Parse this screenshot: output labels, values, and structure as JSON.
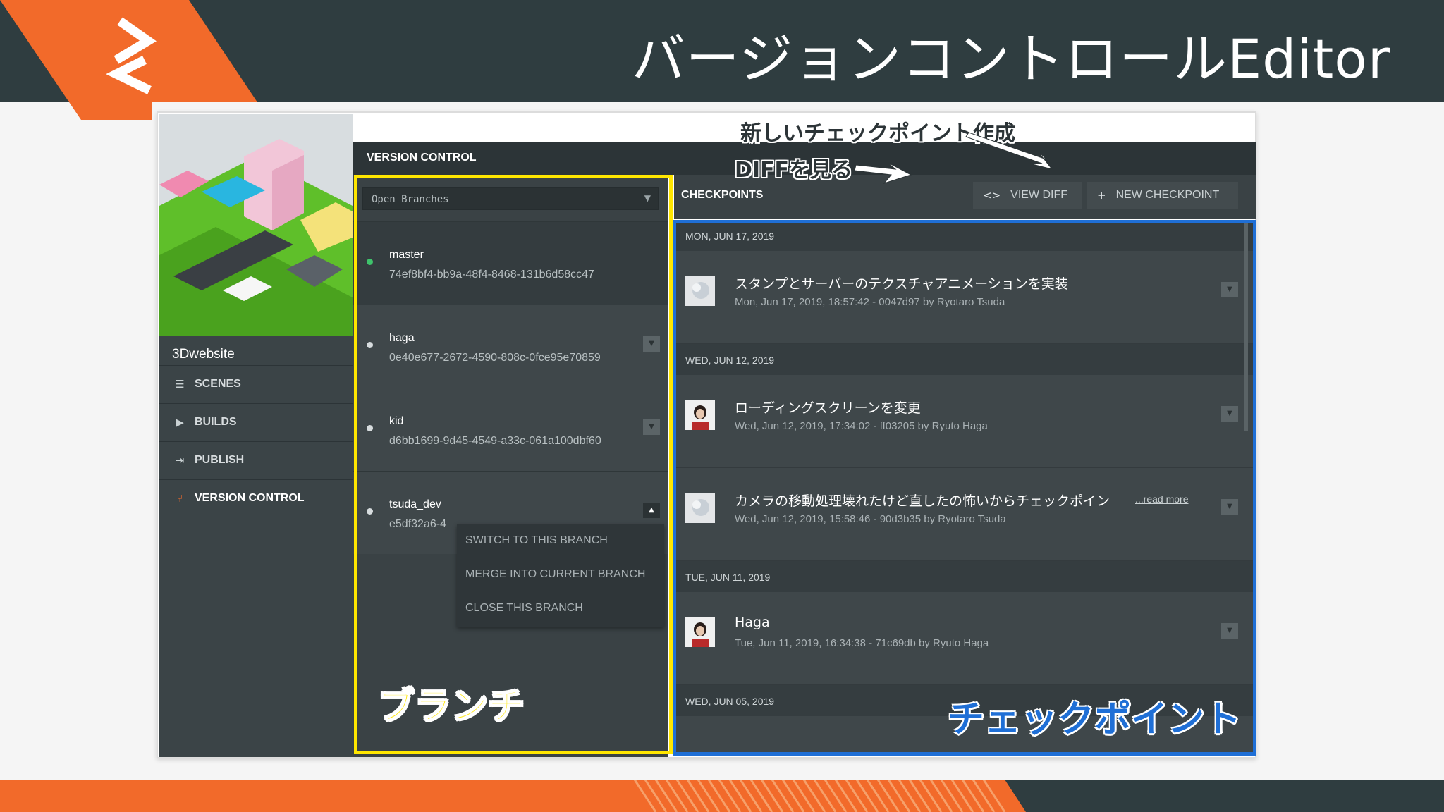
{
  "slide": {
    "title": "バージョンコントロールEditor",
    "colors": {
      "dark": "#2f3d40",
      "accent": "#f26a2a"
    }
  },
  "annotations": {
    "new_checkpoint": "新しいチェックポイント作成",
    "view_diff": "DIFFを見る",
    "branch": "ブランチ",
    "checkpoint": "チェックポイント",
    "colors": {
      "branch_highlight": "#ffe600",
      "checkpoint_highlight": "#1f6fd6"
    }
  },
  "app": {
    "project_name": "3Dwebsite",
    "nav": [
      {
        "label": "SCENES",
        "icon": "list-icon"
      },
      {
        "label": "BUILDS",
        "icon": "play-icon"
      },
      {
        "label": "PUBLISH",
        "icon": "publish-icon"
      },
      {
        "label": "VERSION CONTROL",
        "icon": "branch-icon",
        "active": true
      }
    ],
    "vc_title": "VERSION CONTROL",
    "branches": {
      "selector_label": "Open Branches",
      "items": [
        {
          "name": "master",
          "hash": "74ef8bf4-bb9a-48f4-8468-131b6d58cc47",
          "current": true
        },
        {
          "name": "haga",
          "hash": "0e40e677-2672-4590-808c-0fce95e70859"
        },
        {
          "name": "kid",
          "hash": "d6bb1699-9d45-4549-a33c-061a100dbf60"
        },
        {
          "name": "tsuda_dev",
          "hash": "e5df32a6-4"
        }
      ],
      "context_menu": [
        "SWITCH TO THIS BRANCH",
        "MERGE INTO CURRENT BRANCH",
        "CLOSE THIS BRANCH"
      ]
    },
    "checkpoints": {
      "title": "CHECKPOINTS",
      "view_diff_label": "VIEW DIFF",
      "new_checkpoint_label": "NEW CHECKPOINT",
      "read_more": "...read more",
      "groups": [
        {
          "date": "MON, JUN 17, 2019",
          "items": [
            {
              "message": "スタンプとサーバーのテクスチャアニメーションを実装",
              "meta": "Mon, Jun 17, 2019, 18:57:42 - 0047d97 by Ryotaro Tsuda"
            }
          ]
        },
        {
          "date": "WED, JUN 12, 2019",
          "items": [
            {
              "message": "ローディングスクリーンを変更",
              "meta": "Wed, Jun 12, 2019, 17:34:02 - ff03205 by Ryuto Haga"
            },
            {
              "message": "カメラの移動処理壊れたけど直したの怖いからチェックポイン",
              "meta": "Wed, Jun 12, 2019, 15:58:46 - 90d3b35 by Ryotaro Tsuda"
            }
          ]
        },
        {
          "date": "TUE, JUN 11, 2019",
          "items": [
            {
              "message": "Haga",
              "meta": "Tue, Jun 11, 2019, 16:34:38 - 71c69db by Ryuto Haga"
            }
          ]
        },
        {
          "date": "WED, JUN 05, 2019",
          "items": []
        }
      ]
    }
  }
}
